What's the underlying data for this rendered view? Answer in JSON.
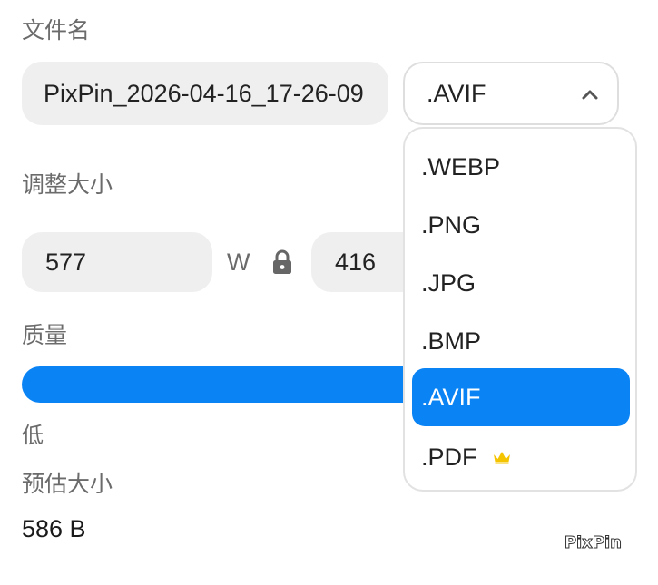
{
  "filename": {
    "label": "文件名",
    "value": "PixPin_2026-04-16_17-26-09"
  },
  "format": {
    "selected": ".AVIF",
    "options": [
      {
        "label": ".WEBP",
        "premium": false
      },
      {
        "label": ".PNG",
        "premium": false
      },
      {
        "label": ".JPG",
        "premium": false
      },
      {
        "label": ".BMP",
        "premium": false
      },
      {
        "label": ".AVIF",
        "premium": false,
        "selected": true
      },
      {
        "label": ".PDF",
        "premium": true
      }
    ],
    "icon": "chevron-up-icon"
  },
  "resize": {
    "label": "调整大小",
    "width": "577",
    "width_unit": "W",
    "height": "416",
    "lock_icon": "lock-icon"
  },
  "quality": {
    "label": "质量",
    "low_label": "低"
  },
  "estimate": {
    "label": "预估大小",
    "value": "586 B"
  },
  "watermark": "PixPin",
  "colors": {
    "accent": "#0a84f5",
    "crown": "#f5c400",
    "field_bg": "#efefef"
  }
}
